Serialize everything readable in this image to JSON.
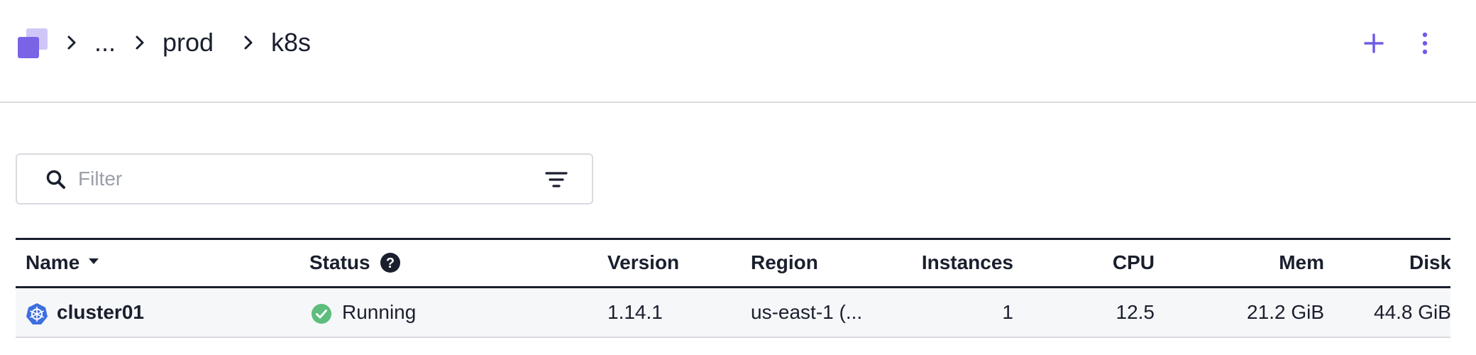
{
  "header": {
    "breadcrumb": [
      "...",
      "prod",
      "k8s"
    ],
    "add_icon": "plus-icon",
    "menu_icon": "more-vertical-icon",
    "accent_color": "#6e5ce6"
  },
  "filter": {
    "placeholder": "Filter",
    "value": "",
    "search_icon": "search-icon",
    "options_icon": "filter-lines-icon"
  },
  "table": {
    "columns": [
      "Name",
      "Status",
      "Version",
      "Region",
      "Instances",
      "CPU",
      "Mem",
      "Disk"
    ],
    "sort": {
      "column": "Name",
      "direction": "descending"
    },
    "status_help_icon": "question-circle-icon",
    "rows": [
      {
        "icon": "kubernetes-icon",
        "name": "cluster01",
        "status": "Running",
        "status_color": "#5dbd7c",
        "version": "1.14.1",
        "region": "us-east-1 (...",
        "instances": "1",
        "cpu": "12.5",
        "mem": "21.2 GiB",
        "disk": "44.8 GiB"
      }
    ]
  }
}
